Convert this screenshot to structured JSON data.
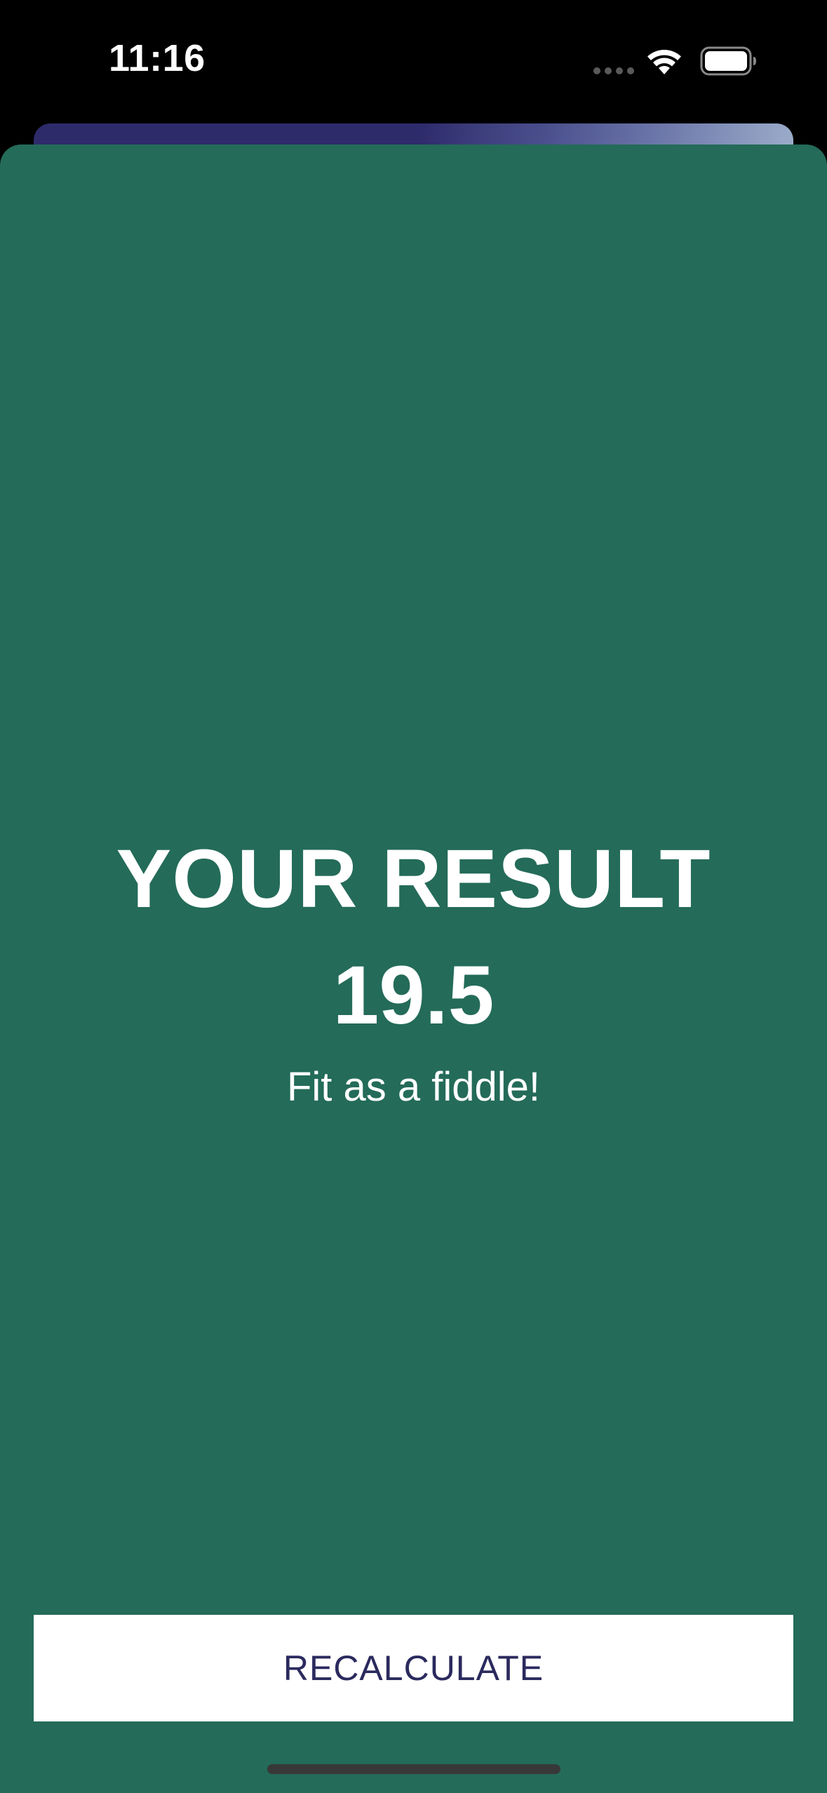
{
  "status_bar": {
    "time": "11:16",
    "icons": [
      "cellular-signal-icon",
      "wifi-icon",
      "battery-icon"
    ]
  },
  "result": {
    "title": "YOUR RESULT",
    "value": "19.5",
    "message": "Fit as a fiddle!"
  },
  "actions": {
    "recalculate_label": "RECALCULATE"
  },
  "colors": {
    "sheet_background": "#246b59",
    "background_sheet": "#2e2b6b",
    "button_background": "#ffffff",
    "button_text": "#2b2a5e",
    "text_primary": "#ffffff"
  }
}
